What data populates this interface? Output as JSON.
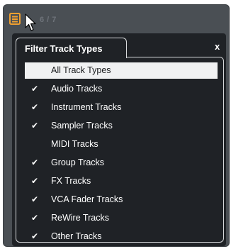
{
  "toolbar": {
    "filter_icon": "filter-track-types-icon",
    "count": "6 / 7",
    "accent_color": "#f0a030"
  },
  "popup": {
    "title": "Filter Track Types",
    "close_label": "x",
    "items": [
      {
        "label": "All Track Types",
        "checked": false,
        "selected": true
      },
      {
        "label": "Audio Tracks",
        "checked": true,
        "selected": false
      },
      {
        "label": "Instrument Tracks",
        "checked": true,
        "selected": false
      },
      {
        "label": "Sampler Tracks",
        "checked": true,
        "selected": false
      },
      {
        "label": "MIDI Tracks",
        "checked": false,
        "selected": false
      },
      {
        "label": "Group Tracks",
        "checked": true,
        "selected": false
      },
      {
        "label": "FX Tracks",
        "checked": true,
        "selected": false
      },
      {
        "label": "VCA Fader Tracks",
        "checked": true,
        "selected": false
      },
      {
        "label": "ReWire Tracks",
        "checked": true,
        "selected": false
      },
      {
        "label": "Other Tracks",
        "checked": true,
        "selected": false
      }
    ],
    "check_glyph": "✔"
  }
}
